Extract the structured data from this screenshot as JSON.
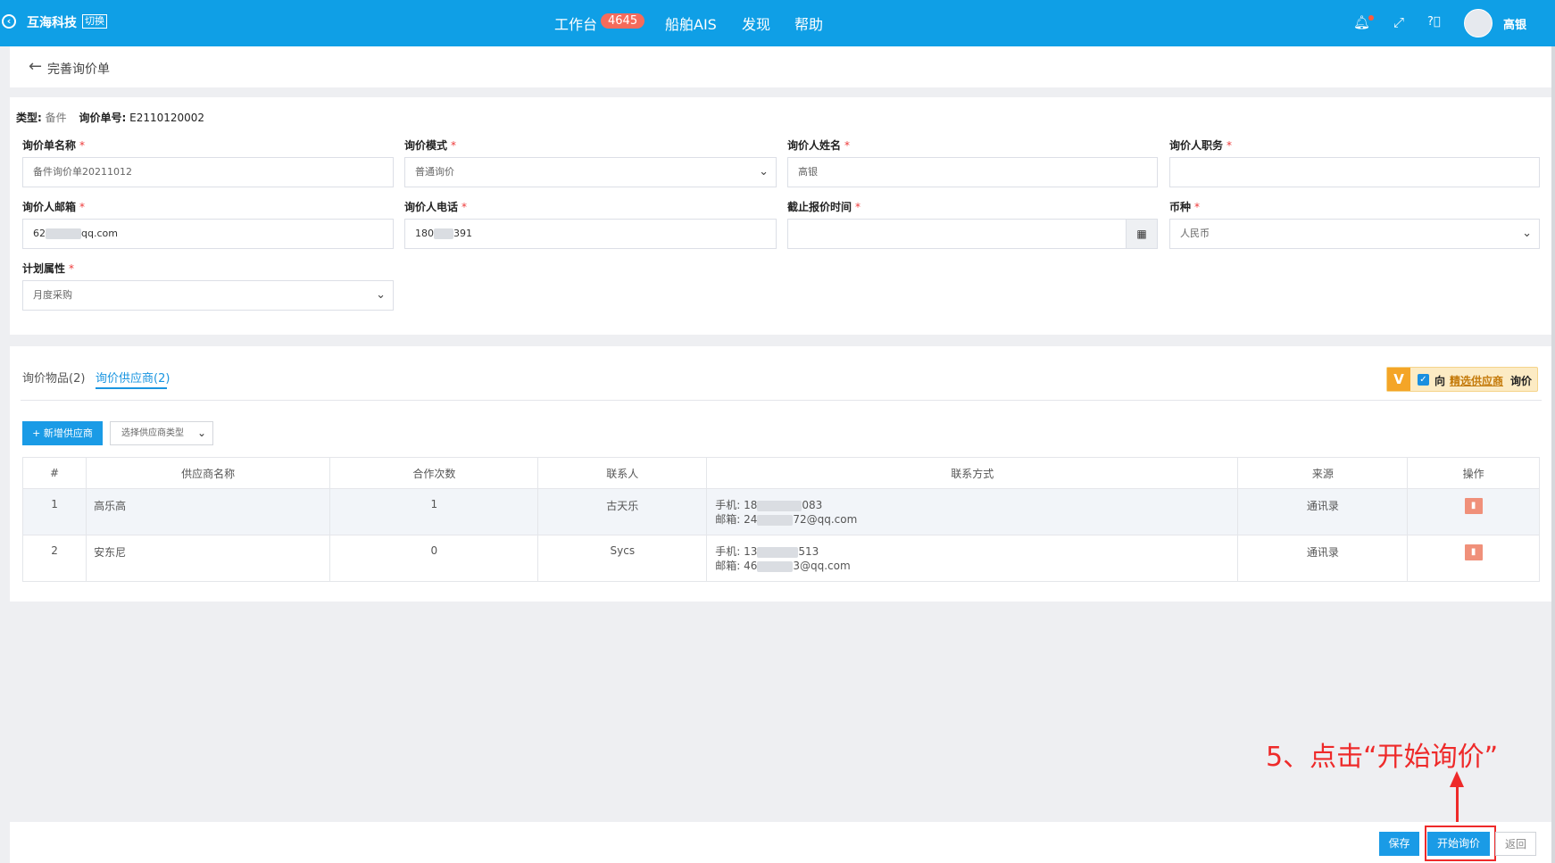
{
  "topbar": {
    "brand": "互海科技",
    "brand_sub": "切换",
    "nav": [
      "工作台",
      "船舶AIS",
      "发现",
      "帮助"
    ],
    "workbench_badge": "4645",
    "user_name": "高银",
    "icons": [
      "bell-icon",
      "fullscreen-icon",
      "help-icon"
    ]
  },
  "breadcrumb": {
    "label": "完善询价单"
  },
  "meta": {
    "type_label": "类型:",
    "type_value": "备件",
    "no_label": "询价单号:",
    "no_value": "E2110120002"
  },
  "form": {
    "name_label": "询价单名称",
    "name_value": "备件询价单20211012",
    "mode_label": "询价模式",
    "mode_value": "普通询价",
    "person_label": "询价人姓名",
    "person_value": "高银",
    "title_label": "询价人职务",
    "title_value": "",
    "email_label": "询价人邮箱",
    "email_prefix": "62",
    "email_suffix": "qq.com",
    "phone_label": "询价人电话",
    "phone_prefix": "180",
    "phone_suffix": "391",
    "deadline_label": "截止报价时间",
    "deadline_value": "",
    "currency_label": "币种",
    "currency_value": "人民币",
    "plan_label": "计划属性",
    "plan_value": "月度采购",
    "required_mark": "*"
  },
  "tabs": [
    {
      "label": "询价物品(2)",
      "active": false
    },
    {
      "label": "询价供应商(2)",
      "active": true
    }
  ],
  "preferred": {
    "v": "V",
    "check": "✓",
    "t1": "向",
    "t2": "精选供应商",
    "t3": "询价"
  },
  "toolbar": {
    "add_label": "新增供应商",
    "add_icon": "+",
    "type_placeholder": "选择供应商类型"
  },
  "table": {
    "headers": [
      "#",
      "供应商名称",
      "合作次数",
      "联系人",
      "联系方式",
      "来源",
      "操作"
    ],
    "rows": [
      {
        "no": "1",
        "name": "高乐高",
        "count": "1",
        "contact": "古天乐",
        "phone_label": "手机:",
        "phone_a": "18",
        "phone_b": "083",
        "email_label": "邮箱:",
        "email_a": "24",
        "email_b": "72@qq.com",
        "source": "通讯录"
      },
      {
        "no": "2",
        "name": "安东尼",
        "count": "0",
        "contact": "Sycs",
        "phone_label": "手机:",
        "phone_a": "13",
        "phone_b": "513",
        "email_label": "邮箱:",
        "email_a": "46",
        "email_b": "3@qq.com",
        "source": "通讯录"
      }
    ]
  },
  "annotation": "5、点击“开始询价”",
  "footer": {
    "save": "保存",
    "start": "开始询价",
    "back": "返回"
  },
  "colors": {
    "primary": "#0f9fe6",
    "danger": "#ee2a2a",
    "badge": "#f56b5b"
  }
}
